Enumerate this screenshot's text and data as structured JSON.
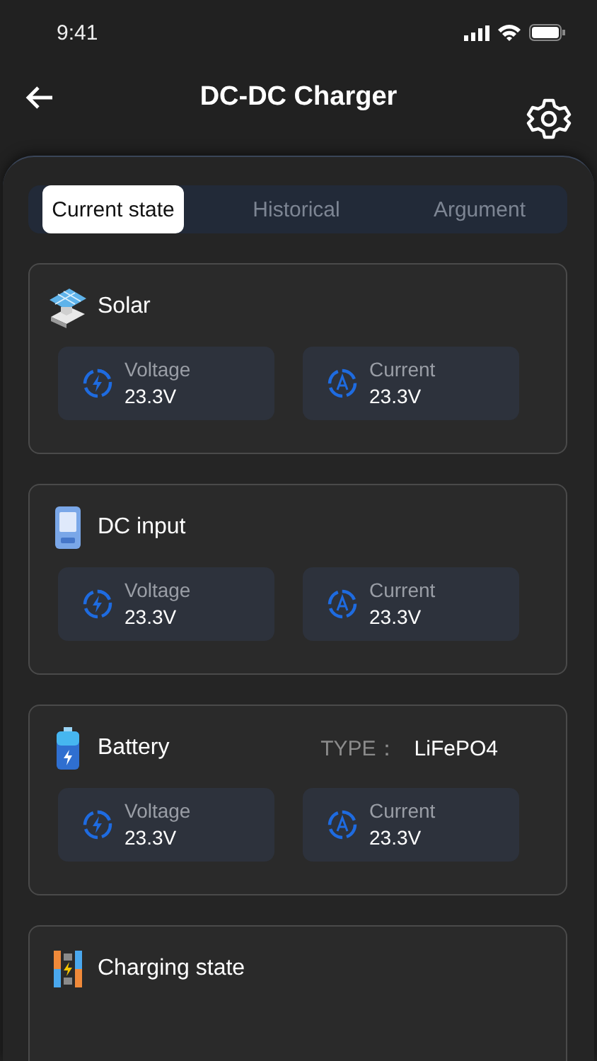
{
  "status_bar": {
    "time": "9:41"
  },
  "header": {
    "title": "DC-DC Charger"
  },
  "tabs": [
    {
      "label": "Current state",
      "selected": true
    },
    {
      "label": "Historical",
      "selected": false
    },
    {
      "label": "Argument",
      "selected": false
    }
  ],
  "sections": [
    {
      "kind": "solar",
      "title": "Solar",
      "metrics": [
        {
          "kind": "voltage",
          "label": "Voltage",
          "value": "23.3V"
        },
        {
          "kind": "current",
          "label": "Current",
          "value": "23.3V"
        }
      ]
    },
    {
      "kind": "dc",
      "title": "DC input",
      "metrics": [
        {
          "kind": "voltage",
          "label": "Voltage",
          "value": "23.3V"
        },
        {
          "kind": "current",
          "label": "Current",
          "value": "23.3V"
        }
      ]
    },
    {
      "kind": "battery",
      "title": "Battery",
      "type_label": "TYPE：",
      "type_value": "LiFePO4",
      "metrics": [
        {
          "kind": "voltage",
          "label": "Voltage",
          "value": "23.3V"
        },
        {
          "kind": "current",
          "label": "Current",
          "value": "23.3V"
        }
      ]
    },
    {
      "kind": "charging",
      "title": "Charging state"
    }
  ]
}
